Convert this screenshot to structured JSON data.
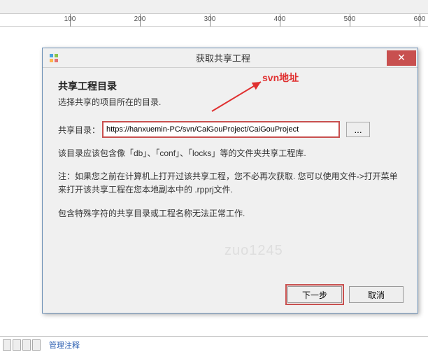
{
  "ruler": {
    "ticks": [
      100,
      200,
      300,
      400,
      500,
      600
    ]
  },
  "dialog": {
    "title": "获取共享工程",
    "heading": "共享工程目录",
    "subtext": "选择共享的项目所在的目录.",
    "url_label": "共享目录：",
    "url_value": "https://hanxuemin-PC/svn/CaiGouProject/CaiGouProject",
    "browse_label": "...",
    "line1": "该目录应该包含像「db」、「conf」、「locks」等的文件夹共享工程库.",
    "line2": "注：如果您之前在计算机上打开过该共享工程，您不必再次获取. 您可以使用文件->打开菜单来打开该共享工程在您本地副本中的 .rpprj文件.",
    "line3": "包含特殊字符的共享目录或工程名称无法正常工作.",
    "next_label": "下一步",
    "cancel_label": "取消"
  },
  "annotation": {
    "label": "svn地址"
  },
  "watermark": "zuo1245",
  "bottom": {
    "link": "管理注释"
  }
}
